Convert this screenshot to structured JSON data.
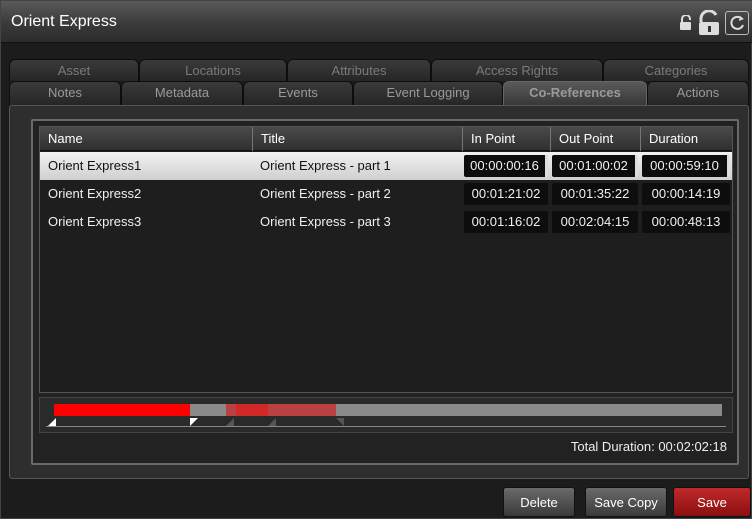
{
  "window": {
    "title": "Orient Express"
  },
  "title_icons": [
    "lock-small-icon",
    "lock-large-icon",
    "refresh-icon"
  ],
  "tabs_back": [
    {
      "label": "Asset"
    },
    {
      "label": "Locations"
    },
    {
      "label": "Attributes"
    },
    {
      "label": "Access Rights"
    },
    {
      "label": "Categories"
    }
  ],
  "tabs_front": [
    {
      "label": "Notes"
    },
    {
      "label": "Metadata"
    },
    {
      "label": "Events"
    },
    {
      "label": "Event Logging"
    },
    {
      "label": "Co-References",
      "active": true
    },
    {
      "label": "Actions"
    }
  ],
  "grid": {
    "columns": [
      "Name",
      "Title",
      "In Point",
      "Out Point",
      "Duration"
    ],
    "rows": [
      {
        "name": "Orient Express1",
        "title": "Orient Express - part 1",
        "in": "00:00:00:16",
        "out": "00:01:00:02",
        "duration": "00:00:59:10",
        "selected": true
      },
      {
        "name": "Orient Express2",
        "title": "Orient Express - part 2",
        "in": "00:01:21:02",
        "out": "00:01:35:22",
        "duration": "00:00:14:19"
      },
      {
        "name": "Orient Express3",
        "title": "Orient Express - part 3",
        "in": "00:01:16:02",
        "out": "00:02:04:15",
        "duration": "00:00:48:13"
      }
    ]
  },
  "timeline": {
    "total_duration_label": "Total Duration:",
    "total_duration_value": "00:02:02:18",
    "colors": {
      "selected_segment": "#ff0000",
      "other_segment": "#c03030",
      "track": "#8a8a8a"
    }
  },
  "buttons": {
    "delete": "Delete",
    "save_copy": "Save Copy",
    "save": "Save"
  }
}
